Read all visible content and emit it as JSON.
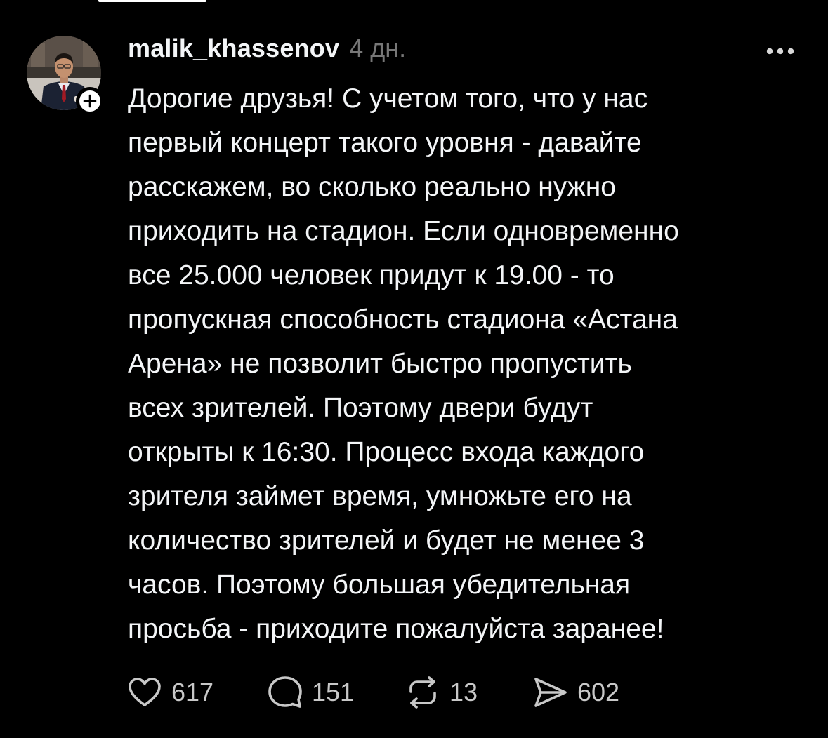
{
  "post": {
    "author": {
      "username": "malik_khassenov",
      "avatar_icon": "person-in-suit-avatar",
      "follow_icon": "plus-icon"
    },
    "timestamp": "4 дн.",
    "more_icon": "more-dots-icon",
    "text_lines": [
      "Дорогие друзья! С учетом того, что у нас",
      "первый концерт такого уровня - давайте",
      "расскажем, во сколько реально нужно",
      "приходить на стадион. Если одновременно",
      "все 25.000 человек придут к 19.00 - то",
      "пропускная способность стадиона «Астана",
      "Арена» не позволит быстро пропустить",
      "всех зрителей. Поэтому двери будут",
      "открыты к 16:30. Процесс входа каждого",
      "зрителя займет время, умножьте его на",
      "количество зрителей и будет не менее 3",
      "часов. Поэтому большая убедительная",
      "просьба - приходите пожалуйста заранее!"
    ],
    "actions": {
      "likes": "617",
      "replies": "151",
      "reposts": "13",
      "shares": "602"
    }
  },
  "colors": {
    "background": "#000000",
    "text": "#f3f5f7",
    "secondary": "#777777",
    "counts": "#c8c8c8"
  }
}
